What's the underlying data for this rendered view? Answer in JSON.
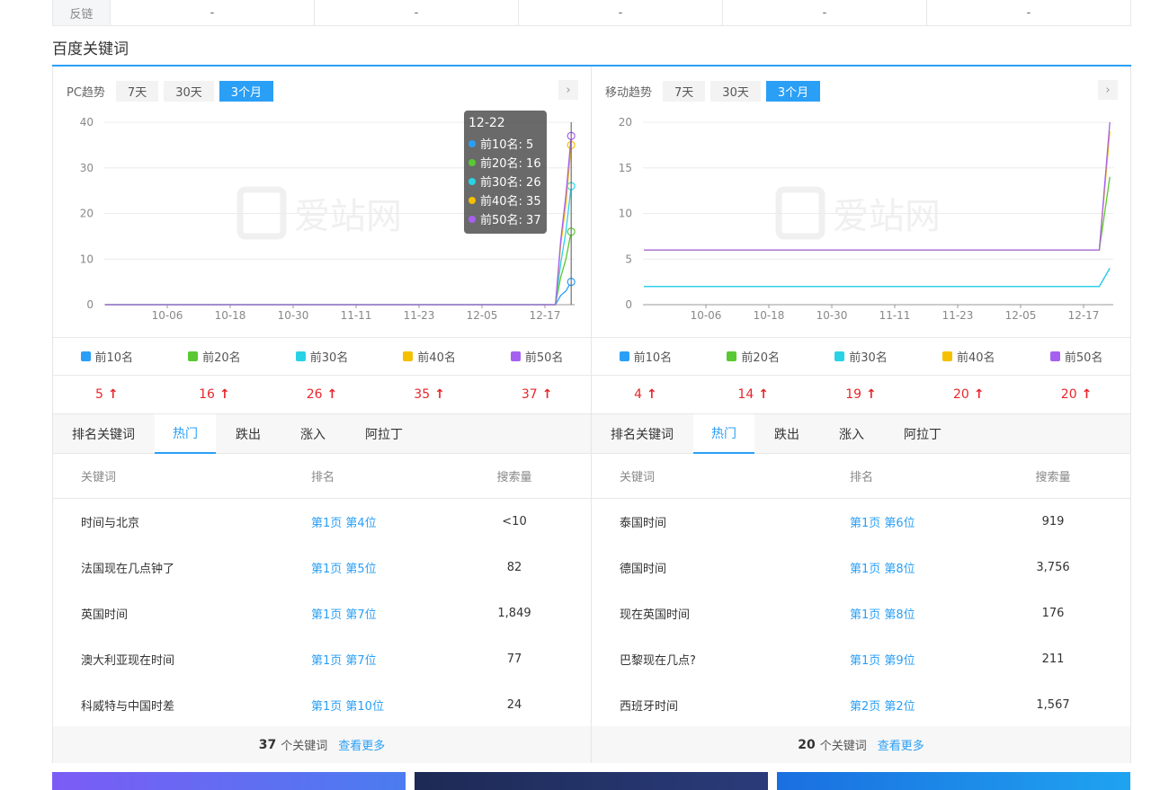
{
  "top_row": {
    "label": "反链",
    "cells": [
      "-",
      "-",
      "-",
      "-",
      "-"
    ]
  },
  "section_title": "百度关键词",
  "panels": [
    {
      "title": "PC趋势",
      "ranges": [
        "7天",
        "30天",
        "3个月"
      ],
      "active_range": "3个月",
      "nav_icon": "chevron-right-icon",
      "watermark": "爱站网",
      "chart_data": {
        "type": "line",
        "x_ticks": [
          "10-06",
          "10-18",
          "10-30",
          "11-11",
          "11-23",
          "12-05",
          "12-17"
        ],
        "y_ticks": [
          0,
          10,
          20,
          30,
          40
        ],
        "ylim": [
          0,
          40
        ],
        "grid": true,
        "note_flat_until": "12-19",
        "series": [
          {
            "name": "前10名",
            "color": "#2a9ff6",
            "baseline": 0,
            "points": [
              [
                "12-19",
                0
              ],
              [
                "12-20",
                2
              ],
              [
                "12-21",
                3
              ],
              [
                "12-22",
                5
              ]
            ]
          },
          {
            "name": "前20名",
            "color": "#5ac832",
            "baseline": 0,
            "points": [
              [
                "12-19",
                0
              ],
              [
                "12-20",
                6
              ],
              [
                "12-21",
                10
              ],
              [
                "12-22",
                16
              ]
            ]
          },
          {
            "name": "前30名",
            "color": "#2ad2e6",
            "baseline": 0,
            "points": [
              [
                "12-19",
                0
              ],
              [
                "12-20",
                9
              ],
              [
                "12-21",
                16
              ],
              [
                "12-22",
                26
              ]
            ]
          },
          {
            "name": "前40名",
            "color": "#f5c000",
            "baseline": 0,
            "points": [
              [
                "12-19",
                0
              ],
              [
                "12-20",
                13
              ],
              [
                "12-21",
                22
              ],
              [
                "12-22",
                35
              ]
            ]
          },
          {
            "name": "前50名",
            "color": "#a660f0",
            "baseline": 0,
            "points": [
              [
                "12-19",
                0
              ],
              [
                "12-20",
                14
              ],
              [
                "12-21",
                24
              ],
              [
                "12-22",
                37
              ]
            ]
          }
        ]
      },
      "tooltip": {
        "date": "12-22",
        "rows": [
          {
            "label": "前10名: 5",
            "color": "#2a9ff6"
          },
          {
            "label": "前20名: 16",
            "color": "#5ac832"
          },
          {
            "label": "前30名: 26",
            "color": "#2ad2e6"
          },
          {
            "label": "前40名: 35",
            "color": "#f5c000"
          },
          {
            "label": "前50名: 37",
            "color": "#a660f0"
          }
        ]
      },
      "legend": [
        {
          "label": "前10名",
          "color": "#2a9ff6"
        },
        {
          "label": "前20名",
          "color": "#5ac832"
        },
        {
          "label": "前30名",
          "color": "#2ad2e6"
        },
        {
          "label": "前40名",
          "color": "#f5c000"
        },
        {
          "label": "前50名",
          "color": "#a660f0"
        }
      ],
      "counts": [
        "5",
        "16",
        "26",
        "35",
        "37"
      ],
      "tabs": [
        "排名关键词",
        "热门",
        "跌出",
        "涨入",
        "阿拉丁"
      ],
      "active_tab": "热门",
      "table_headers": [
        "关键词",
        "排名",
        "搜索量"
      ],
      "rows": [
        {
          "keyword": "时间与北京",
          "rank": "第1页 第4位",
          "volume": "<10"
        },
        {
          "keyword": "法国现在几点钟了",
          "rank": "第1页 第5位",
          "volume": "82"
        },
        {
          "keyword": "英国时间",
          "rank": "第1页 第7位",
          "volume": "1,849"
        },
        {
          "keyword": "澳大利亚现在时间",
          "rank": "第1页 第7位",
          "volume": "77"
        },
        {
          "keyword": "科威特与中国时差",
          "rank": "第1页 第10位",
          "volume": "24"
        }
      ],
      "footer": {
        "count": "37",
        "unit": "个关键词",
        "more": "查看更多"
      }
    },
    {
      "title": "移动趋势",
      "ranges": [
        "7天",
        "30天",
        "3个月"
      ],
      "active_range": "3个月",
      "nav_icon": "chevron-right-icon",
      "watermark": "爱站网",
      "chart_data": {
        "type": "line",
        "x_ticks": [
          "10-06",
          "10-18",
          "10-30",
          "11-11",
          "11-23",
          "12-05",
          "12-17"
        ],
        "y_ticks": [
          0,
          5,
          10,
          15,
          20
        ],
        "ylim": [
          0,
          20
        ],
        "grid": true,
        "series": [
          {
            "name": "前10名",
            "color": "#2a9ff6",
            "baseline": 2,
            "points": [
              [
                "12-20",
                2
              ],
              [
                "12-22",
                4
              ]
            ]
          },
          {
            "name": "前20名",
            "color": "#5ac832",
            "baseline": 6,
            "points": [
              [
                "12-20",
                6
              ],
              [
                "12-22",
                14
              ]
            ]
          },
          {
            "name": "前30名",
            "color": "#2ad2e6",
            "baseline": 2,
            "points": [
              [
                "12-20",
                2
              ],
              [
                "12-22",
                4
              ]
            ]
          },
          {
            "name": "前40名",
            "color": "#f5c000",
            "baseline": 6,
            "points": [
              [
                "12-20",
                6
              ],
              [
                "12-22",
                19
              ]
            ]
          },
          {
            "name": "前50名",
            "color": "#a660f0",
            "baseline": 6,
            "points": [
              [
                "12-20",
                6
              ],
              [
                "12-22",
                20
              ]
            ]
          }
        ]
      },
      "legend": [
        {
          "label": "前10名",
          "color": "#2a9ff6"
        },
        {
          "label": "前20名",
          "color": "#5ac832"
        },
        {
          "label": "前30名",
          "color": "#2ad2e6"
        },
        {
          "label": "前40名",
          "color": "#f5c000"
        },
        {
          "label": "前50名",
          "color": "#a660f0"
        }
      ],
      "counts": [
        "4",
        "14",
        "19",
        "20",
        "20"
      ],
      "tabs": [
        "排名关键词",
        "热门",
        "跌出",
        "涨入",
        "阿拉丁"
      ],
      "active_tab": "热门",
      "table_headers": [
        "关键词",
        "排名",
        "搜索量"
      ],
      "rows": [
        {
          "keyword": "泰国时间",
          "rank": "第1页 第6位",
          "volume": "919"
        },
        {
          "keyword": "德国时间",
          "rank": "第1页 第8位",
          "volume": "3,756"
        },
        {
          "keyword": "现在英国时间",
          "rank": "第1页 第8位",
          "volume": "176"
        },
        {
          "keyword": "巴黎现在几点?",
          "rank": "第1页 第9位",
          "volume": "211"
        },
        {
          "keyword": "西班牙时间",
          "rank": "第2页 第2位",
          "volume": "1,567"
        }
      ],
      "footer": {
        "count": "20",
        "unit": "个关键词",
        "more": "查看更多"
      }
    }
  ],
  "banners": [
    {
      "color_a": "#7b5cf5",
      "color_b": "#4b7cf0"
    },
    {
      "color_a": "#1d2a55",
      "color_b": "#2a3b7a"
    },
    {
      "color_a": "#1a6fe0",
      "color_b": "#1fa3f0"
    }
  ]
}
